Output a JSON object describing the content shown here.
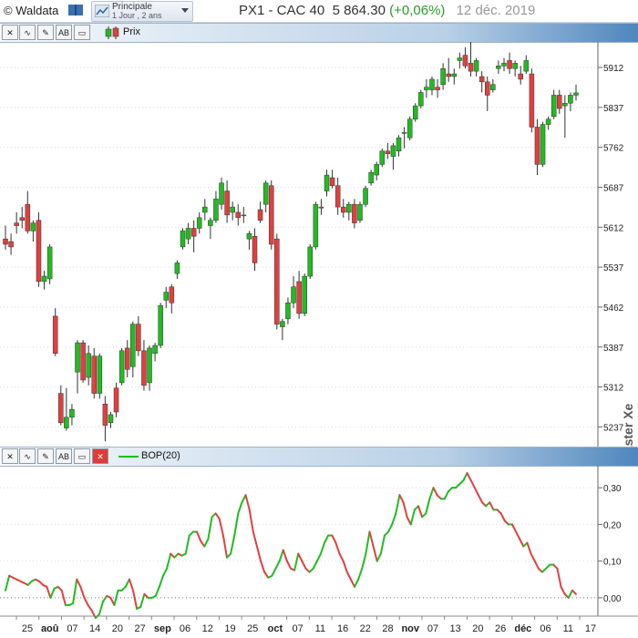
{
  "header": {
    "brand": "© Waldata",
    "selector_title": "Principale",
    "selector_sub": "1 Jour , 2 ans",
    "instrument": "PX1 - CAC 40",
    "price": "5 864.30",
    "change": "(+0,06%)",
    "date": "12 déc. 2019"
  },
  "price_pane": {
    "legend": "Prix",
    "watermark": "Walmaster Xe",
    "colors": {
      "up": "#22bb22",
      "down": "#e04040",
      "grid": "#dddddd"
    },
    "y_ticks": [
      "5912",
      "5837",
      "5762",
      "5687",
      "5612",
      "5537",
      "5462",
      "5387",
      "5312",
      "5237"
    ]
  },
  "indicator_pane": {
    "legend": "BOP(20)",
    "y_ticks": [
      "0,30",
      "0,20",
      "0,10",
      "0,00"
    ]
  },
  "x_axis": {
    "labels": [
      "25",
      "aoû",
      "07",
      "14",
      "20",
      "27",
      "sep",
      "06",
      "12",
      "19",
      "25",
      "oct",
      "07",
      "11",
      "16",
      "22",
      "28",
      "nov",
      "07",
      "13",
      "20",
      "26",
      "déc",
      "06",
      "11",
      "17"
    ],
    "bold": [
      "aoû",
      "sep",
      "oct",
      "nov",
      "déc"
    ]
  },
  "chart_data": [
    {
      "type": "candlestick",
      "title": "PX1 - CAC 40",
      "ylim": [
        5200,
        5960
      ],
      "y_ticks": [
        5912,
        5837,
        5762,
        5687,
        5612,
        5537,
        5462,
        5387,
        5312,
        5237
      ],
      "candles": [
        {
          "o": 5590,
          "h": 5615,
          "l": 5570,
          "c": 5580
        },
        {
          "o": 5585,
          "h": 5600,
          "l": 5560,
          "c": 5575
        },
        {
          "o": 5620,
          "h": 5640,
          "l": 5600,
          "c": 5615
        },
        {
          "o": 5630,
          "h": 5650,
          "l": 5610,
          "c": 5625
        },
        {
          "o": 5655,
          "h": 5680,
          "l": 5600,
          "c": 5605
        },
        {
          "o": 5605,
          "h": 5625,
          "l": 5585,
          "c": 5620
        },
        {
          "o": 5625,
          "h": 5640,
          "l": 5500,
          "c": 5510
        },
        {
          "o": 5510,
          "h": 5530,
          "l": 5495,
          "c": 5520
        },
        {
          "o": 5515,
          "h": 5580,
          "l": 5505,
          "c": 5575
        },
        {
          "o": 5445,
          "h": 5460,
          "l": 5370,
          "c": 5375
        },
        {
          "o": 5300,
          "h": 5315,
          "l": 5240,
          "c": 5245
        },
        {
          "o": 5235,
          "h": 5310,
          "l": 5230,
          "c": 5255
        },
        {
          "o": 5255,
          "h": 5280,
          "l": 5240,
          "c": 5270
        },
        {
          "o": 5340,
          "h": 5400,
          "l": 5300,
          "c": 5395
        },
        {
          "o": 5395,
          "h": 5400,
          "l": 5320,
          "c": 5325
        },
        {
          "o": 5330,
          "h": 5390,
          "l": 5315,
          "c": 5375
        },
        {
          "o": 5370,
          "h": 5385,
          "l": 5290,
          "c": 5300
        },
        {
          "o": 5300,
          "h": 5375,
          "l": 5290,
          "c": 5370
        },
        {
          "o": 5280,
          "h": 5295,
          "l": 5210,
          "c": 5240
        },
        {
          "o": 5245,
          "h": 5265,
          "l": 5235,
          "c": 5260
        },
        {
          "o": 5310,
          "h": 5320,
          "l": 5255,
          "c": 5265
        },
        {
          "o": 5320,
          "h": 5385,
          "l": 5315,
          "c": 5380
        },
        {
          "o": 5385,
          "h": 5400,
          "l": 5330,
          "c": 5345
        },
        {
          "o": 5350,
          "h": 5435,
          "l": 5330,
          "c": 5430
        },
        {
          "o": 5430,
          "h": 5445,
          "l": 5370,
          "c": 5380
        },
        {
          "o": 5380,
          "h": 5400,
          "l": 5305,
          "c": 5315
        },
        {
          "o": 5320,
          "h": 5390,
          "l": 5305,
          "c": 5385
        },
        {
          "o": 5375,
          "h": 5395,
          "l": 5360,
          "c": 5390
        },
        {
          "o": 5390,
          "h": 5470,
          "l": 5385,
          "c": 5465
        },
        {
          "o": 5475,
          "h": 5500,
          "l": 5460,
          "c": 5490
        },
        {
          "o": 5500,
          "h": 5505,
          "l": 5450,
          "c": 5470
        },
        {
          "o": 5525,
          "h": 5550,
          "l": 5515,
          "c": 5545
        },
        {
          "o": 5575,
          "h": 5610,
          "l": 5570,
          "c": 5605
        },
        {
          "o": 5590,
          "h": 5620,
          "l": 5580,
          "c": 5610
        },
        {
          "o": 5610,
          "h": 5625,
          "l": 5565,
          "c": 5595
        },
        {
          "o": 5610,
          "h": 5640,
          "l": 5600,
          "c": 5630
        },
        {
          "o": 5640,
          "h": 5665,
          "l": 5625,
          "c": 5650
        },
        {
          "o": 5615,
          "h": 5630,
          "l": 5590,
          "c": 5625
        },
        {
          "o": 5625,
          "h": 5680,
          "l": 5620,
          "c": 5665
        },
        {
          "o": 5655,
          "h": 5705,
          "l": 5645,
          "c": 5695
        },
        {
          "o": 5680,
          "h": 5700,
          "l": 5620,
          "c": 5635
        },
        {
          "o": 5640,
          "h": 5660,
          "l": 5625,
          "c": 5650
        },
        {
          "o": 5640,
          "h": 5655,
          "l": 5615,
          "c": 5630
        },
        {
          "o": 5635,
          "h": 5650,
          "l": 5620,
          "c": 5635
        },
        {
          "o": 5590,
          "h": 5605,
          "l": 5570,
          "c": 5600
        },
        {
          "o": 5595,
          "h": 5610,
          "l": 5530,
          "c": 5545
        },
        {
          "o": 5645,
          "h": 5660,
          "l": 5620,
          "c": 5625
        },
        {
          "o": 5655,
          "h": 5700,
          "l": 5640,
          "c": 5695
        },
        {
          "o": 5690,
          "h": 5700,
          "l": 5570,
          "c": 5580
        },
        {
          "o": 5590,
          "h": 5600,
          "l": 5420,
          "c": 5430
        },
        {
          "o": 5425,
          "h": 5440,
          "l": 5400,
          "c": 5435
        },
        {
          "o": 5440,
          "h": 5480,
          "l": 5430,
          "c": 5470
        },
        {
          "o": 5470,
          "h": 5520,
          "l": 5460,
          "c": 5500
        },
        {
          "o": 5510,
          "h": 5530,
          "l": 5440,
          "c": 5450
        },
        {
          "o": 5450,
          "h": 5525,
          "l": 5445,
          "c": 5520
        },
        {
          "o": 5520,
          "h": 5580,
          "l": 5515,
          "c": 5575
        },
        {
          "o": 5575,
          "h": 5660,
          "l": 5570,
          "c": 5655
        },
        {
          "o": 5650,
          "h": 5665,
          "l": 5635,
          "c": 5648
        },
        {
          "o": 5680,
          "h": 5720,
          "l": 5670,
          "c": 5710
        },
        {
          "o": 5705,
          "h": 5720,
          "l": 5685,
          "c": 5690
        },
        {
          "o": 5690,
          "h": 5705,
          "l": 5635,
          "c": 5650
        },
        {
          "o": 5650,
          "h": 5665,
          "l": 5630,
          "c": 5640
        },
        {
          "o": 5640,
          "h": 5660,
          "l": 5625,
          "c": 5655
        },
        {
          "o": 5655,
          "h": 5665,
          "l": 5610,
          "c": 5620
        },
        {
          "o": 5625,
          "h": 5660,
          "l": 5620,
          "c": 5655
        },
        {
          "o": 5655,
          "h": 5690,
          "l": 5650,
          "c": 5685
        },
        {
          "o": 5695,
          "h": 5720,
          "l": 5690,
          "c": 5715
        },
        {
          "o": 5710,
          "h": 5735,
          "l": 5700,
          "c": 5730
        },
        {
          "o": 5730,
          "h": 5760,
          "l": 5725,
          "c": 5755
        },
        {
          "o": 5755,
          "h": 5770,
          "l": 5740,
          "c": 5750
        },
        {
          "o": 5745,
          "h": 5770,
          "l": 5720,
          "c": 5765
        },
        {
          "o": 5755,
          "h": 5785,
          "l": 5745,
          "c": 5780
        },
        {
          "o": 5790,
          "h": 5800,
          "l": 5760,
          "c": 5790
        },
        {
          "o": 5780,
          "h": 5820,
          "l": 5775,
          "c": 5815
        },
        {
          "o": 5815,
          "h": 5845,
          "l": 5810,
          "c": 5840
        },
        {
          "o": 5840,
          "h": 5870,
          "l": 5835,
          "c": 5865
        },
        {
          "o": 5870,
          "h": 5890,
          "l": 5855,
          "c": 5875
        },
        {
          "o": 5870,
          "h": 5895,
          "l": 5860,
          "c": 5890
        },
        {
          "o": 5875,
          "h": 5890,
          "l": 5855,
          "c": 5870
        },
        {
          "o": 5880,
          "h": 5920,
          "l": 5870,
          "c": 5910
        },
        {
          "o": 5900,
          "h": 5930,
          "l": 5885,
          "c": 5895
        },
        {
          "o": 5895,
          "h": 5910,
          "l": 5880,
          "c": 5900
        },
        {
          "o": 5925,
          "h": 5940,
          "l": 5910,
          "c": 5930
        },
        {
          "o": 5935,
          "h": 5950,
          "l": 5910,
          "c": 5915
        },
        {
          "o": 5920,
          "h": 5960,
          "l": 5895,
          "c": 5905
        },
        {
          "o": 5905,
          "h": 5930,
          "l": 5895,
          "c": 5925
        },
        {
          "o": 5895,
          "h": 5905,
          "l": 5865,
          "c": 5885
        },
        {
          "o": 5885,
          "h": 5895,
          "l": 5830,
          "c": 5860
        },
        {
          "o": 5870,
          "h": 5890,
          "l": 5865,
          "c": 5880
        },
        {
          "o": 5910,
          "h": 5925,
          "l": 5900,
          "c": 5915
        },
        {
          "o": 5915,
          "h": 5930,
          "l": 5905,
          "c": 5920
        },
        {
          "o": 5925,
          "h": 5940,
          "l": 5900,
          "c": 5910
        },
        {
          "o": 5910,
          "h": 5925,
          "l": 5895,
          "c": 5920
        },
        {
          "o": 5900,
          "h": 5915,
          "l": 5880,
          "c": 5890
        },
        {
          "o": 5905,
          "h": 5935,
          "l": 5900,
          "c": 5925
        },
        {
          "o": 5900,
          "h": 5910,
          "l": 5790,
          "c": 5800
        },
        {
          "o": 5800,
          "h": 5815,
          "l": 5710,
          "c": 5730
        },
        {
          "o": 5730,
          "h": 5810,
          "l": 5725,
          "c": 5805
        },
        {
          "o": 5805,
          "h": 5820,
          "l": 5795,
          "c": 5815
        },
        {
          "o": 5820,
          "h": 5870,
          "l": 5815,
          "c": 5860
        },
        {
          "o": 5860,
          "h": 5870,
          "l": 5825,
          "c": 5835
        },
        {
          "o": 5840,
          "h": 5860,
          "l": 5780,
          "c": 5845
        },
        {
          "o": 5845,
          "h": 5865,
          "l": 5830,
          "c": 5860
        },
        {
          "o": 5860,
          "h": 5880,
          "l": 5850,
          "c": 5864.3
        }
      ]
    },
    {
      "type": "line",
      "series": [
        {
          "name": "BOP(20)"
        }
      ],
      "ylim": [
        -0.05,
        0.36
      ],
      "y_ticks": [
        0.3,
        0.2,
        0.1,
        0.0
      ],
      "values": [
        0.02,
        0.06,
        0.055,
        0.05,
        0.045,
        0.04,
        0.035,
        0.045,
        0.05,
        0.045,
        0.035,
        0.03,
        0.0,
        0.025,
        0.03,
        0.02,
        -0.02,
        -0.02,
        -0.015,
        0.05,
        0.03,
        0.0,
        -0.02,
        -0.035,
        -0.055,
        -0.045,
        -0.01,
        0.005,
        0.0,
        -0.02,
        0.02,
        0.02,
        0.03,
        0.05,
        0.02,
        -0.03,
        -0.025,
        0.01,
        0.0,
        0.0,
        0.005,
        0.03,
        0.06,
        0.08,
        0.12,
        0.11,
        0.12,
        0.115,
        0.12,
        0.17,
        0.18,
        0.18,
        0.155,
        0.14,
        0.16,
        0.22,
        0.23,
        0.215,
        0.17,
        0.11,
        0.12,
        0.17,
        0.23,
        0.26,
        0.28,
        0.24,
        0.18,
        0.14,
        0.1,
        0.07,
        0.055,
        0.06,
        0.08,
        0.1,
        0.13,
        0.1,
        0.08,
        0.075,
        0.12,
        0.1,
        0.08,
        0.07,
        0.08,
        0.1,
        0.12,
        0.15,
        0.17,
        0.17,
        0.15,
        0.12,
        0.1,
        0.07,
        0.05,
        0.03,
        0.05,
        0.08,
        0.12,
        0.18,
        0.14,
        0.1,
        0.12,
        0.17,
        0.18,
        0.2,
        0.23,
        0.28,
        0.26,
        0.22,
        0.2,
        0.24,
        0.25,
        0.22,
        0.23,
        0.27,
        0.3,
        0.28,
        0.27,
        0.27,
        0.29,
        0.3,
        0.3,
        0.31,
        0.32,
        0.34,
        0.32,
        0.3,
        0.28,
        0.26,
        0.25,
        0.26,
        0.24,
        0.24,
        0.23,
        0.21,
        0.2,
        0.2,
        0.18,
        0.16,
        0.14,
        0.15,
        0.12,
        0.1,
        0.08,
        0.07,
        0.08,
        0.09,
        0.09,
        0.08,
        0.03,
        0.01,
        0.0,
        0.02,
        0.01
      ]
    }
  ]
}
